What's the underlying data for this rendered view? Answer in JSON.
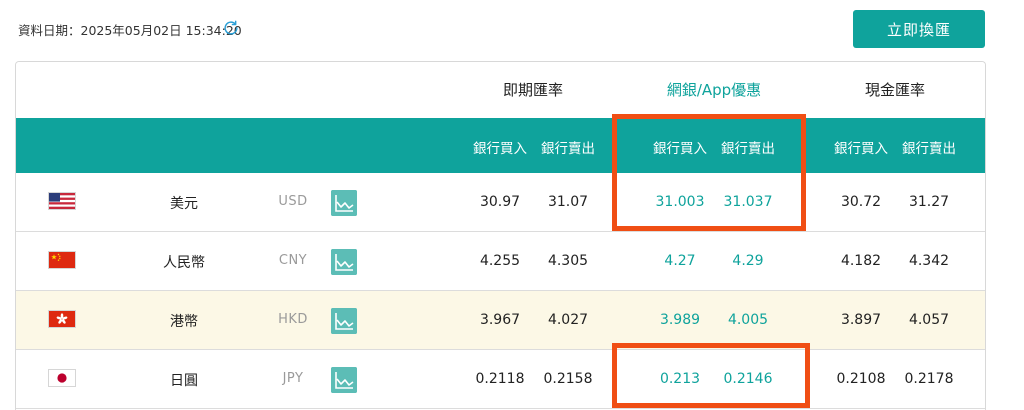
{
  "header": {
    "timestamp": "資料日期：2025年05月02日 15:34:20",
    "refresh_icon": "refresh-icon",
    "exchange_button": "立即換匯"
  },
  "table": {
    "groups": [
      {
        "title": "即期匯率"
      },
      {
        "title": "網銀/App優惠",
        "color": "#0fa39c"
      },
      {
        "title": "現金匯率"
      }
    ],
    "sub_headers": [
      "銀行買入",
      "銀行賣出",
      "銀行買入",
      "銀行賣出",
      "銀行買入",
      "銀行賣出"
    ],
    "header_color": "#0fa39c",
    "rows": [
      {
        "flag": "us-flag",
        "name": "美元",
        "code": "USD",
        "spot_buy": "30.97",
        "spot_sell": "31.07",
        "online_buy": "31.003",
        "online_sell": "31.037",
        "cash_buy": "30.72",
        "cash_sell": "31.27"
      },
      {
        "flag": "cn-flag",
        "name": "人民幣",
        "code": "CNY",
        "spot_buy": "4.255",
        "spot_sell": "4.305",
        "online_buy": "4.27",
        "online_sell": "4.29",
        "cash_buy": "4.182",
        "cash_sell": "4.342"
      },
      {
        "flag": "hk-flag",
        "name": "港幣",
        "code": "HKD",
        "spot_buy": "3.967",
        "spot_sell": "4.027",
        "online_buy": "3.989",
        "online_sell": "4.005",
        "cash_buy": "3.897",
        "cash_sell": "4.057",
        "highlighted": true
      },
      {
        "flag": "jp-flag",
        "name": "日圓",
        "code": "JPY",
        "spot_buy": "0.2118",
        "spot_sell": "0.2158",
        "online_buy": "0.213",
        "online_sell": "0.2146",
        "cash_buy": "0.2108",
        "cash_sell": "0.2178"
      }
    ],
    "highlight_color": "#f04e14"
  }
}
